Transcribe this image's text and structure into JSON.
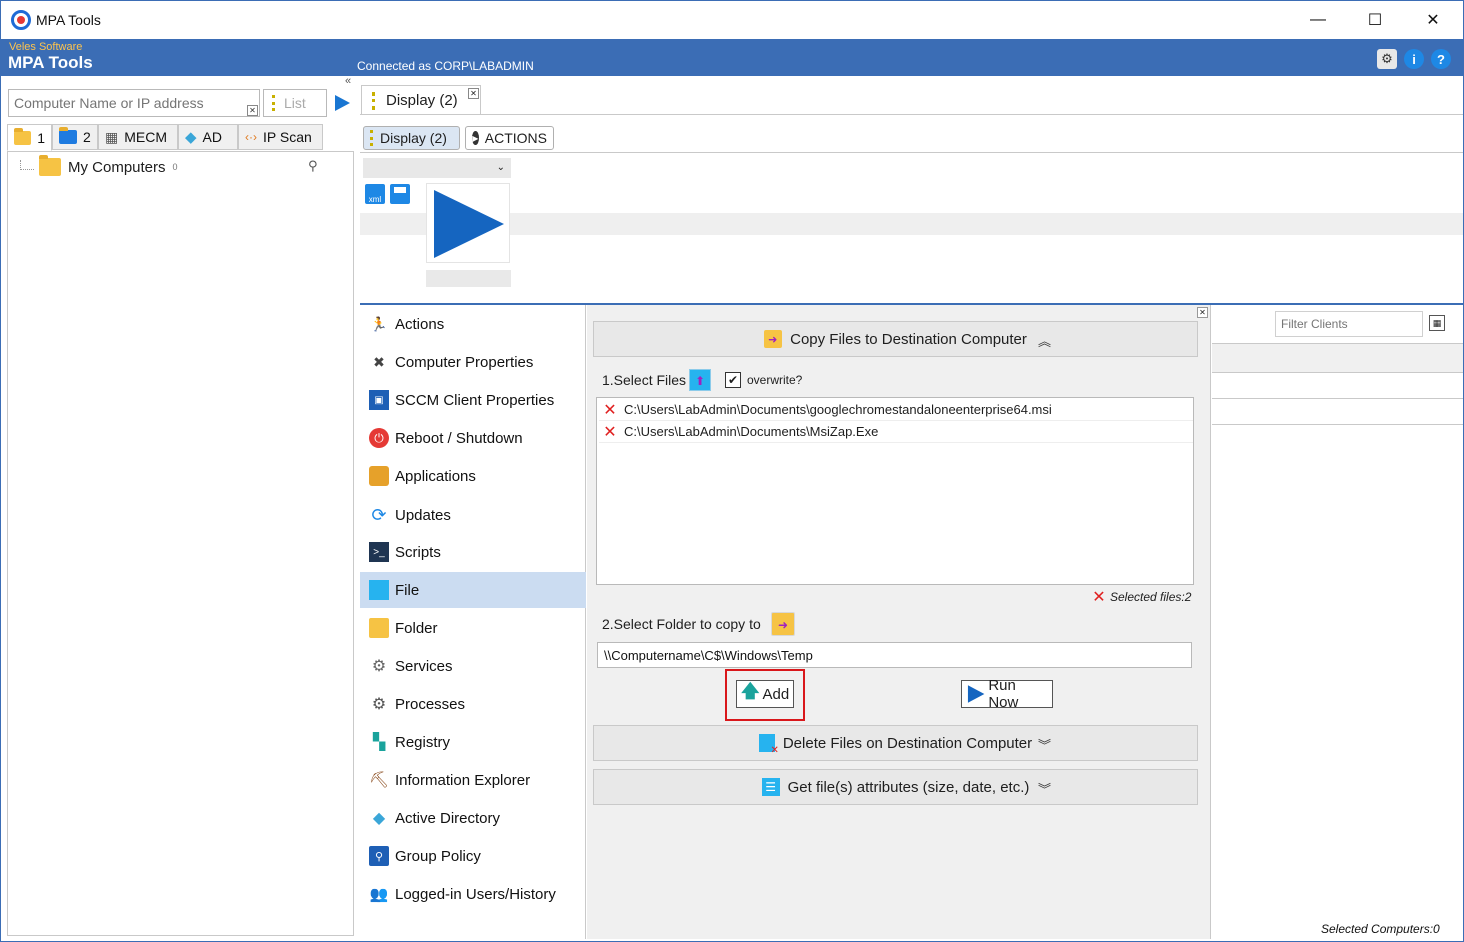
{
  "window": {
    "title": "MPA Tools",
    "minimize": "—",
    "maximize": "☐",
    "close": "✕"
  },
  "banner": {
    "vendor": "Veles Software",
    "product": "MPA Tools",
    "connected": "Connected as CORP\\LABADMIN"
  },
  "left": {
    "search_placeholder": "Computer Name or IP address",
    "list_label": "List",
    "tabs": [
      {
        "label": "1"
      },
      {
        "label": "2"
      },
      {
        "label": "MECM"
      },
      {
        "label": "AD"
      },
      {
        "label": "IP Scan"
      }
    ],
    "tree": {
      "root_label": "My Computers",
      "root_count": "0"
    }
  },
  "doc_tab": {
    "label": "Display (2)"
  },
  "subtabs": {
    "display": "Display (2)",
    "actions": "ACTIONS"
  },
  "categories": [
    {
      "label": "Actions",
      "icon": "run-icon"
    },
    {
      "label": "Computer Properties",
      "icon": "tools-icon"
    },
    {
      "label": "SCCM Client Properties",
      "icon": "sccm-icon"
    },
    {
      "label": "Reboot / Shutdown",
      "icon": "power-icon"
    },
    {
      "label": "Applications",
      "icon": "briefcase-icon"
    },
    {
      "label": "Updates",
      "icon": "refresh-icon"
    },
    {
      "label": "Scripts",
      "icon": "terminal-icon"
    },
    {
      "label": "File",
      "icon": "file-icon"
    },
    {
      "label": "Folder",
      "icon": "folder-icon"
    },
    {
      "label": "Services",
      "icon": "gears-icon"
    },
    {
      "label": "Processes",
      "icon": "process-icon"
    },
    {
      "label": "Registry",
      "icon": "registry-icon"
    },
    {
      "label": "Information Explorer",
      "icon": "pickaxe-icon"
    },
    {
      "label": "Active Directory",
      "icon": "ad-icon"
    },
    {
      "label": "Group Policy",
      "icon": "policy-icon"
    },
    {
      "label": "Logged-in Users/History",
      "icon": "users-icon"
    }
  ],
  "copy_panel": {
    "title": "Copy Files to Destination Computer",
    "select_files_label": "1.Select Files",
    "overwrite_label": "overwrite?",
    "overwrite_checked": true,
    "files": [
      "C:\\Users\\LabAdmin\\Documents\\googlechromestandaloneenterprise64.msi",
      "C:\\Users\\LabAdmin\\Documents\\MsiZap.Exe"
    ],
    "selected_files": "Selected files:2",
    "select_folder_label": "2.Select Folder to copy to",
    "destination": "\\\\Computername\\C$\\Windows\\Temp",
    "add_label": "Add",
    "run_now_label": "Run Now"
  },
  "delete_panel": {
    "title": "Delete Files on Destination Computer"
  },
  "attrs_panel": {
    "title": "Get file(s) attributes (size, date, etc.)"
  },
  "right": {
    "filter_placeholder": "Filter Clients",
    "selected_computers": "Selected Computers:0"
  },
  "colors": {
    "accent": "#3b6db5",
    "highlight": "#d9171b",
    "selected_row": "#cbdcf1"
  }
}
